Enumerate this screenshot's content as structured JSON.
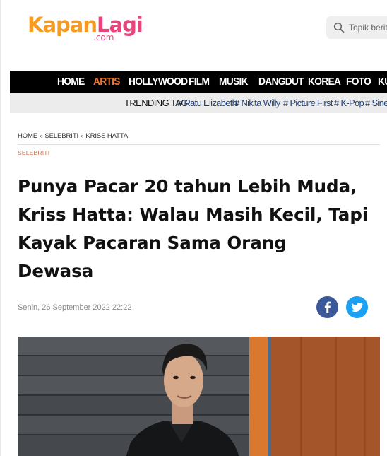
{
  "header": {
    "logo_part1": "Kapan",
    "logo_part2": "Lagi",
    "logo_sub": ".com",
    "search": {
      "placeholder": "Topik berita",
      "icon": "search-icon"
    }
  },
  "nav": {
    "items": [
      {
        "label": "HOME"
      },
      {
        "label": "ARTIS",
        "active": true
      },
      {
        "label": "HOLLYWOOD"
      },
      {
        "label": "FILM"
      },
      {
        "label": "MUSIK"
      },
      {
        "label": "DANGDUT"
      },
      {
        "label": "KOREA"
      },
      {
        "label": "FOTO"
      },
      {
        "label": "KU"
      }
    ],
    "active_color": "#f0742a"
  },
  "trending": {
    "label": "TRENDING TAG",
    "tags": [
      "# Ratu Elizabeth",
      "# Nikita Willy",
      "# Picture First",
      "# K-Pop",
      "# Sinet"
    ]
  },
  "article": {
    "breadcrumb": [
      "HOME",
      "SELEBRITI",
      "KRISS HATTA"
    ],
    "breadcrumb_sep": "»",
    "category": "SELEBRITI",
    "title_lines": [
      "Punya Pacar 20 tahun Lebih Muda,",
      "Kriss Hatta: Walau Masih Kecil, Tapi",
      "Kayak Pacaran Sama Orang",
      "Dewasa"
    ],
    "date": "Senin, 26 September 2022 22:22",
    "share": [
      {
        "network": "facebook",
        "icon": "facebook-icon",
        "color": "#3b5998"
      },
      {
        "network": "twitter",
        "icon": "twitter-icon",
        "color": "#1da1f2"
      }
    ]
  },
  "colors": {
    "logo_orange": "#f59a23",
    "logo_pink": "#e9457d",
    "trending_tag": "#1c3f7a",
    "category": "#c07550"
  }
}
